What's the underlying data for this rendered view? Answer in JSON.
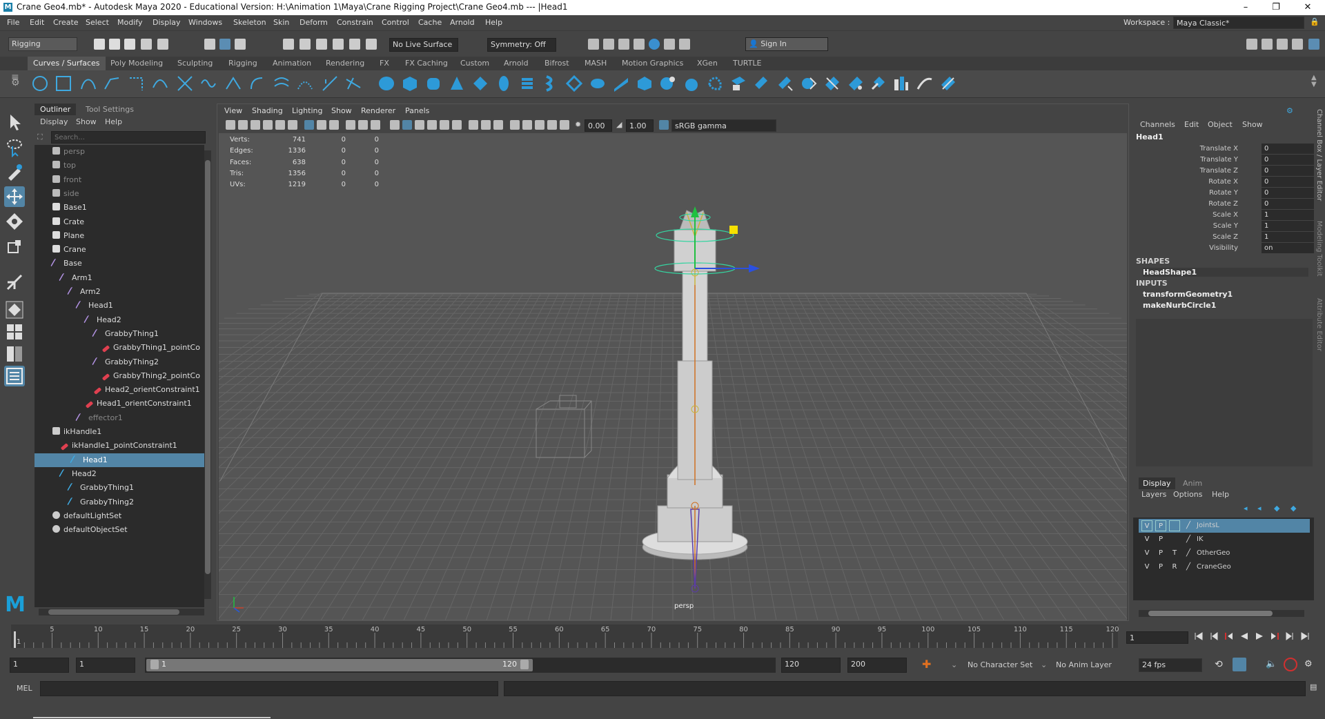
{
  "window": {
    "title": "Crane Geo4.mb* - Autodesk Maya 2020 - Educational Version: H:\\Animation 1\\Maya\\Crane Rigging Project\\Crane Geo4.mb  ---  |Head1",
    "logo": "M",
    "controls": [
      "–",
      "❐",
      "✕"
    ]
  },
  "menubar": {
    "items": [
      "File",
      "Edit",
      "Create",
      "Select",
      "Modify",
      "Display",
      "Windows",
      "Skeleton",
      "Skin",
      "Deform",
      "Constrain",
      "Control",
      "Cache",
      "Arnold",
      "Help"
    ],
    "workspace_label": "Workspace :",
    "workspace_value": "Maya Classic*"
  },
  "statusline": {
    "menuset": "Rigging",
    "live_surface": "No Live Surface",
    "symmetry": "Symmetry: Off",
    "sign_in": "Sign In"
  },
  "shelf": {
    "tabs": [
      "Curves / Surfaces",
      "Poly Modeling",
      "Sculpting",
      "Rigging",
      "Animation",
      "Rendering",
      "FX",
      "FX Caching",
      "Custom",
      "Arnold",
      "Bifrost",
      "MASH",
      "Motion Graphics",
      "XGen",
      "TURTLE"
    ],
    "active_tab": "Curves / Surfaces"
  },
  "outliner": {
    "tabs": [
      "Outliner",
      "Tool Settings"
    ],
    "menu": [
      "Display",
      "Show",
      "Help"
    ],
    "search_placeholder": "Search...",
    "items": [
      {
        "label": "persp",
        "depth": 0,
        "kind": "camera",
        "dim": true
      },
      {
        "label": "top",
        "depth": 0,
        "kind": "camera",
        "dim": true
      },
      {
        "label": "front",
        "depth": 0,
        "kind": "camera",
        "dim": true
      },
      {
        "label": "side",
        "depth": 0,
        "kind": "camera",
        "dim": true
      },
      {
        "label": "Base1",
        "depth": 0,
        "kind": "mesh"
      },
      {
        "label": "Crate",
        "depth": 0,
        "kind": "mesh"
      },
      {
        "label": "Plane",
        "depth": 0,
        "kind": "mesh"
      },
      {
        "label": "Crane",
        "depth": 0,
        "kind": "mesh"
      },
      {
        "label": "Base",
        "depth": 0,
        "kind": "joint"
      },
      {
        "label": "Arm1",
        "depth": 1,
        "kind": "joint"
      },
      {
        "label": "Arm2",
        "depth": 2,
        "kind": "joint"
      },
      {
        "label": "Head1",
        "depth": 3,
        "kind": "joint"
      },
      {
        "label": "Head2",
        "depth": 4,
        "kind": "joint"
      },
      {
        "label": "GrabbyThing1",
        "depth": 5,
        "kind": "joint"
      },
      {
        "label": "GrabbyThing1_pointCo",
        "depth": 6,
        "kind": "constraint"
      },
      {
        "label": "GrabbyThing2",
        "depth": 5,
        "kind": "joint"
      },
      {
        "label": "GrabbyThing2_pointCo",
        "depth": 6,
        "kind": "constraint"
      },
      {
        "label": "Head2_orientConstraint1",
        "depth": 5,
        "kind": "constraint"
      },
      {
        "label": "Head1_orientConstraint1",
        "depth": 4,
        "kind": "constraint"
      },
      {
        "label": "effector1",
        "depth": 3,
        "kind": "effector",
        "dim": true
      },
      {
        "label": "ikHandle1",
        "depth": 0,
        "kind": "ik"
      },
      {
        "label": "ikHandle1_pointConstraint1",
        "depth": 1,
        "kind": "constraint"
      },
      {
        "label": "Head1",
        "depth": 0,
        "kind": "curve",
        "selected": true
      },
      {
        "label": "Head2",
        "depth": 1,
        "kind": "curve"
      },
      {
        "label": "GrabbyThing1",
        "depth": 2,
        "kind": "curve"
      },
      {
        "label": "GrabbyThing2",
        "depth": 2,
        "kind": "curve"
      },
      {
        "label": "defaultLightSet",
        "depth": 0,
        "kind": "set"
      },
      {
        "label": "defaultObjectSet",
        "depth": 0,
        "kind": "set"
      }
    ]
  },
  "viewport": {
    "menu": [
      "View",
      "Shading",
      "Lighting",
      "Show",
      "Renderer",
      "Panels"
    ],
    "exposure": "0.00",
    "gamma": "1.00",
    "colorspace": "sRGB gamma",
    "camera_label": "persp",
    "hud": [
      {
        "label": "Verts:",
        "a": "741",
        "b": "0",
        "c": "0"
      },
      {
        "label": "Edges:",
        "a": "1336",
        "b": "0",
        "c": "0"
      },
      {
        "label": "Faces:",
        "a": "638",
        "b": "0",
        "c": "0"
      },
      {
        "label": "Tris:",
        "a": "1356",
        "b": "0",
        "c": "0"
      },
      {
        "label": "UVs:",
        "a": "1219",
        "b": "0",
        "c": "0"
      }
    ]
  },
  "channelbox": {
    "menu": [
      "Channels",
      "Edit",
      "Object",
      "Show"
    ],
    "object": "Head1",
    "channels": [
      {
        "label": "Translate X",
        "value": "0"
      },
      {
        "label": "Translate Y",
        "value": "0"
      },
      {
        "label": "Translate Z",
        "value": "0"
      },
      {
        "label": "Rotate X",
        "value": "0"
      },
      {
        "label": "Rotate Y",
        "value": "0"
      },
      {
        "label": "Rotate Z",
        "value": "0"
      },
      {
        "label": "Scale X",
        "value": "1"
      },
      {
        "label": "Scale Y",
        "value": "1"
      },
      {
        "label": "Scale Z",
        "value": "1"
      },
      {
        "label": "Visibility",
        "value": "on"
      }
    ],
    "shapes_header": "SHAPES",
    "shape": "HeadShape1",
    "inputs_header": "INPUTS",
    "inputs": [
      "transformGeometry1",
      "makeNurbCircle1"
    ]
  },
  "layer_editor": {
    "tabs": [
      "Display",
      "Anim"
    ],
    "menu": [
      "Layers",
      "Options",
      "Help"
    ],
    "layers": [
      {
        "v": "V",
        "p": "P",
        "t": "",
        "name": "JointsL",
        "selected": true
      },
      {
        "v": "V",
        "p": "P",
        "t": "",
        "name": "IK"
      },
      {
        "v": "V",
        "p": "P",
        "t": "T",
        "name": "OtherGeo"
      },
      {
        "v": "V",
        "p": "P",
        "t": "R",
        "name": "CraneGeo"
      }
    ]
  },
  "right_strip": [
    "Channel Box / Layer Editor",
    "Modeling Toolkit",
    "Attribute Editor"
  ],
  "timeline": {
    "ticks": [
      "5",
      "10",
      "15",
      "20",
      "25",
      "30",
      "35",
      "40",
      "45",
      "50",
      "55",
      "60",
      "65",
      "70",
      "75",
      "80",
      "85",
      "90",
      "95",
      "100",
      "105",
      "110",
      "115",
      "120"
    ],
    "start_marker": "1",
    "current_frame": "1"
  },
  "range": {
    "start": "1",
    "playback_start": "1",
    "slider_start": "1",
    "slider_end": "120",
    "playback_end": "120",
    "end": "200",
    "character_set": "No Character Set",
    "anim_layer": "No Anim Layer",
    "fps": "24 fps"
  },
  "cmdline": {
    "label": "MEL"
  }
}
